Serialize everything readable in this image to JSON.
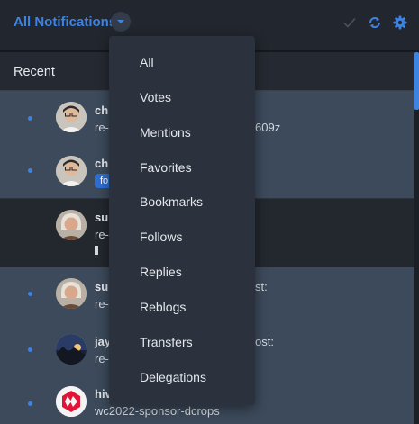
{
  "header": {
    "title": "All Notifications"
  },
  "section": {
    "title": "Recent"
  },
  "notifications": [
    {
      "name": "chi",
      "text": "re-",
      "text_tail": "609z",
      "state": "unread"
    },
    {
      "name": "chi",
      "badge": "fo",
      "state": "unread"
    },
    {
      "name": "su",
      "text": "re-",
      "state": "read"
    },
    {
      "name": "su",
      "text": "re-",
      "text_tail": "st:",
      "state": "unread"
    },
    {
      "name": "jay",
      "text": "re-",
      "text_tail": "ost:",
      "state": "unread"
    },
    {
      "name": "hiv",
      "text": "wc2022-sponsor-dcrops",
      "state": "unread"
    }
  ],
  "dropdown": {
    "items": [
      "All",
      "Votes",
      "Mentions",
      "Favorites",
      "Bookmarks",
      "Follows",
      "Replies",
      "Reblogs",
      "Transfers",
      "Delegations"
    ]
  },
  "icons": {
    "caret": "caret-down-icon",
    "mark_read": "checkmark-icon",
    "refresh": "refresh-icon",
    "settings": "gear-icon"
  },
  "colors": {
    "accent": "#3d83e2",
    "background": "#22262e",
    "unread_row": "#3c4a5b",
    "dropdown_bg": "#2c323d"
  }
}
